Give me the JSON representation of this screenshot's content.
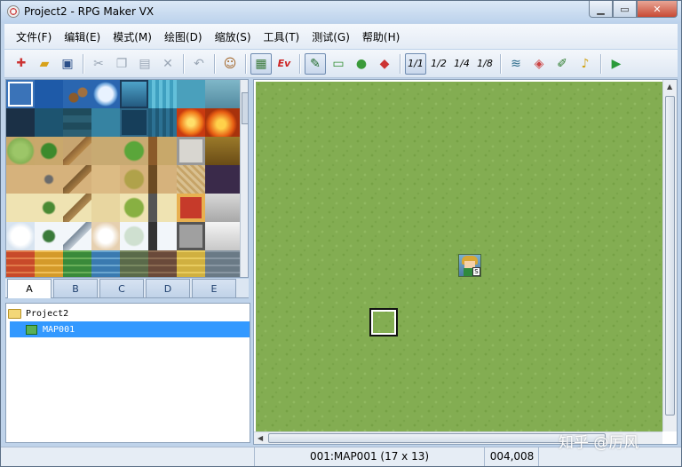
{
  "window": {
    "title": "Project2 - RPG Maker VX"
  },
  "menubar": {
    "items": [
      "文件(F)",
      "编辑(E)",
      "模式(M)",
      "绘图(D)",
      "缩放(S)",
      "工具(T)",
      "测试(G)",
      "帮助(H)"
    ]
  },
  "toolbar": {
    "buttons": [
      {
        "icon": "new-icon",
        "glyph": "✚"
      },
      {
        "icon": "open-icon",
        "glyph": "📂"
      },
      {
        "icon": "save-icon",
        "glyph": "💾"
      },
      {
        "icon": "cut-icon",
        "glyph": "✂"
      },
      {
        "icon": "copy-icon",
        "glyph": "❐"
      },
      {
        "icon": "paste-icon",
        "glyph": "📋"
      },
      {
        "icon": "delete-icon",
        "glyph": "✕"
      },
      {
        "icon": "undo-icon",
        "glyph": "↶"
      },
      {
        "icon": "playtest-character-icon",
        "glyph": "☺"
      },
      {
        "icon": "map-layer-icon",
        "glyph": "▦"
      },
      {
        "icon": "event-layer-icon",
        "glyph": "Ev"
      },
      {
        "icon": "pencil-icon",
        "glyph": "✎"
      },
      {
        "icon": "rectangle-icon",
        "glyph": "▭"
      },
      {
        "icon": "ellipse-icon",
        "glyph": "●"
      },
      {
        "icon": "fill-icon",
        "glyph": "◆"
      },
      {
        "icon": "zoom-1-1-icon",
        "glyph": "1/1"
      },
      {
        "icon": "zoom-1-2-icon",
        "glyph": "1/2"
      },
      {
        "icon": "zoom-1-4-icon",
        "glyph": "1/4"
      },
      {
        "icon": "zoom-1-8-icon",
        "glyph": "1/8"
      },
      {
        "icon": "database-icon",
        "glyph": "≋"
      },
      {
        "icon": "material-icon",
        "glyph": "◈"
      },
      {
        "icon": "script-editor-icon",
        "glyph": "✐"
      },
      {
        "icon": "sound-test-icon",
        "glyph": "♪"
      },
      {
        "icon": "playtest-icon",
        "glyph": "▶"
      }
    ]
  },
  "tileset": {
    "tabs": [
      "A",
      "B",
      "C",
      "D",
      "E"
    ],
    "active_tab": "A"
  },
  "map_tree": {
    "project": "Project2",
    "maps": [
      "MAP001"
    ]
  },
  "status": {
    "map_info": "001:MAP001 (17 x 13)",
    "coords": "004,008"
  },
  "watermark": "知乎 @厉风",
  "colors": {
    "grass": "#83ad52",
    "selection": "#3399ff"
  }
}
